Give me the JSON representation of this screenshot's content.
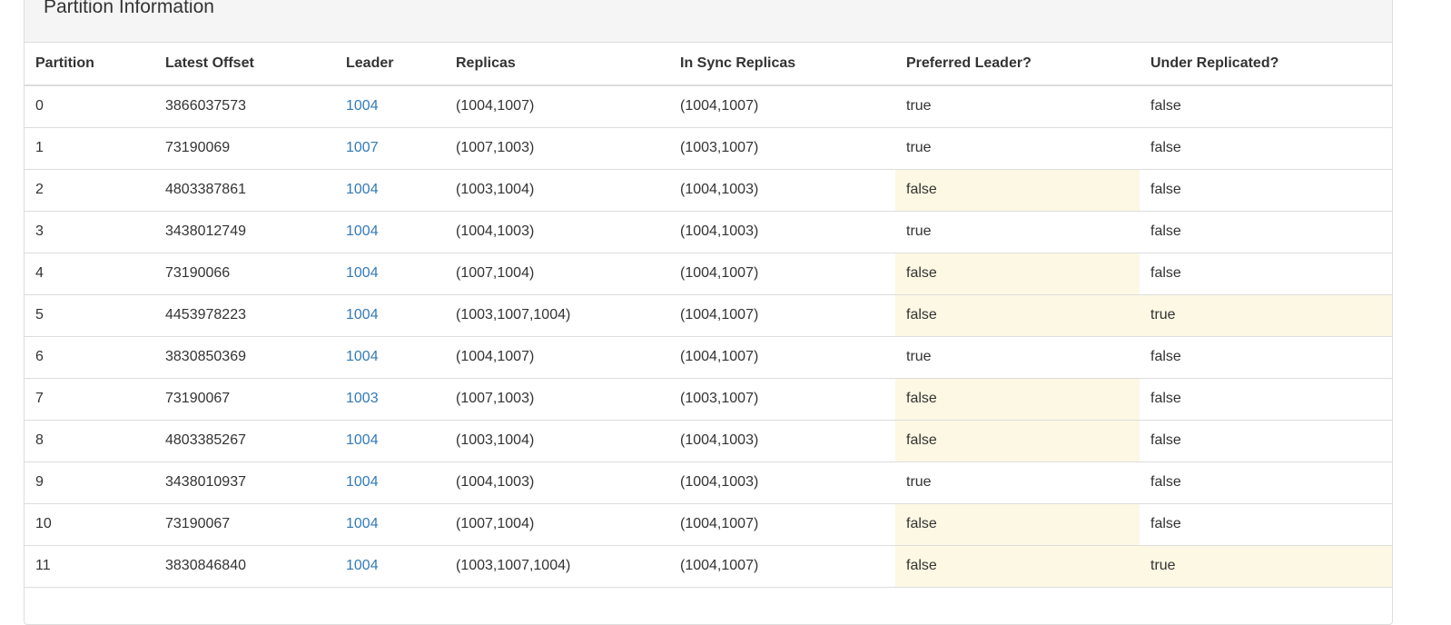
{
  "panel": {
    "title": "Partition Information"
  },
  "table": {
    "columns": [
      "Partition",
      "Latest Offset",
      "Leader",
      "Replicas",
      "In Sync Replicas",
      "Preferred Leader?",
      "Under Replicated?"
    ],
    "rows": [
      {
        "partition": "0",
        "latest_offset": "3866037573",
        "leader": "1004",
        "replicas": "(1004,1007)",
        "isr": "(1004,1007)",
        "preferred_leader": "true",
        "under_replicated": "false"
      },
      {
        "partition": "1",
        "latest_offset": "73190069",
        "leader": "1007",
        "replicas": "(1007,1003)",
        "isr": "(1003,1007)",
        "preferred_leader": "true",
        "under_replicated": "false"
      },
      {
        "partition": "2",
        "latest_offset": "4803387861",
        "leader": "1004",
        "replicas": "(1003,1004)",
        "isr": "(1004,1003)",
        "preferred_leader": "false",
        "under_replicated": "false"
      },
      {
        "partition": "3",
        "latest_offset": "3438012749",
        "leader": "1004",
        "replicas": "(1004,1003)",
        "isr": "(1004,1003)",
        "preferred_leader": "true",
        "under_replicated": "false"
      },
      {
        "partition": "4",
        "latest_offset": "73190066",
        "leader": "1004",
        "replicas": "(1007,1004)",
        "isr": "(1004,1007)",
        "preferred_leader": "false",
        "under_replicated": "false"
      },
      {
        "partition": "5",
        "latest_offset": "4453978223",
        "leader": "1004",
        "replicas": "(1003,1007,1004)",
        "isr": "(1004,1007)",
        "preferred_leader": "false",
        "under_replicated": "true"
      },
      {
        "partition": "6",
        "latest_offset": "3830850369",
        "leader": "1004",
        "replicas": "(1004,1007)",
        "isr": "(1004,1007)",
        "preferred_leader": "true",
        "under_replicated": "false"
      },
      {
        "partition": "7",
        "latest_offset": "73190067",
        "leader": "1003",
        "replicas": "(1007,1003)",
        "isr": "(1003,1007)",
        "preferred_leader": "false",
        "under_replicated": "false"
      },
      {
        "partition": "8",
        "latest_offset": "4803385267",
        "leader": "1004",
        "replicas": "(1003,1004)",
        "isr": "(1004,1003)",
        "preferred_leader": "false",
        "under_replicated": "false"
      },
      {
        "partition": "9",
        "latest_offset": "3438010937",
        "leader": "1004",
        "replicas": "(1004,1003)",
        "isr": "(1004,1003)",
        "preferred_leader": "true",
        "under_replicated": "false"
      },
      {
        "partition": "10",
        "latest_offset": "73190067",
        "leader": "1004",
        "replicas": "(1007,1004)",
        "isr": "(1004,1007)",
        "preferred_leader": "false",
        "under_replicated": "false"
      },
      {
        "partition": "11",
        "latest_offset": "3830846840",
        "leader": "1004",
        "replicas": "(1003,1007,1004)",
        "isr": "(1004,1007)",
        "preferred_leader": "false",
        "under_replicated": "true"
      }
    ]
  },
  "colors": {
    "link": "#337ab7",
    "warning_bg": "#fcf8e3",
    "heading_bg": "#f5f5f5",
    "border": "#dddddd",
    "text": "#333333"
  }
}
